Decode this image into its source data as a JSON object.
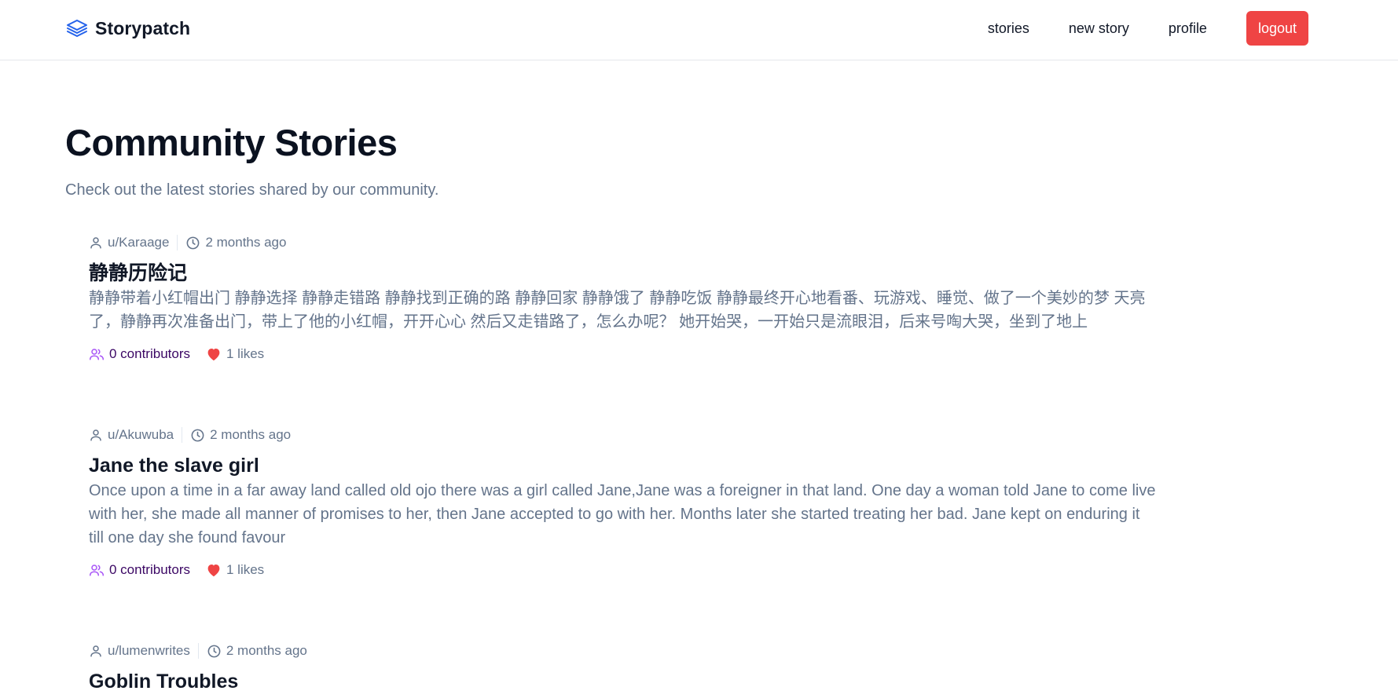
{
  "header": {
    "brand": "Storypatch",
    "nav": [
      "stories",
      "new story",
      "profile"
    ],
    "logout_label": "logout",
    "logout_color": "#ef4444"
  },
  "main": {
    "title": "Community Stories",
    "subtitle": "Check out the latest stories shared by our community."
  },
  "stories": [
    {
      "author": "u/Karaage",
      "time": "2 months ago",
      "title": "静静历险记",
      "excerpt": "静静带着小红帽出门 静静选择 静静走错路 静静找到正确的路 静静回家 静静饿了 静静吃饭 静静最终开心地看番、玩游戏、睡觉、做了一个美妙的梦 天亮了，静静再次准备出门，带上了他的小红帽，开开心心 然后又走错路了，怎么办呢？ 她开始哭，一开始只是流眼泪，后来号啕大哭，坐到了地上",
      "contributors": "0 contributors",
      "likes": "1 likes"
    },
    {
      "author": "u/Akuwuba",
      "time": "2 months ago",
      "title": "Jane the slave girl",
      "excerpt": "Once upon a time in a far away land called old ojo there was a girl called Jane,Jane was a foreigner in that land. One day a woman told Jane to come live with her, she made all manner of promises to her, then Jane accepted to go with her. Months later she started treating her bad. Jane kept on enduring it till one day she found favour",
      "contributors": "0 contributors",
      "likes": "1 likes"
    },
    {
      "author": "u/lumenwrites",
      "time": "2 months ago",
      "title": "Goblin Troubles"
    }
  ],
  "icons": {
    "brand": "layers-icon",
    "author": "user-icon",
    "time": "clock-icon",
    "contributors": "users-icon",
    "likes": "heart-icon"
  },
  "colors": {
    "brand_icon": "#2563eb",
    "contributors_icon": "#a855f7",
    "heart": "#ef4444"
  }
}
